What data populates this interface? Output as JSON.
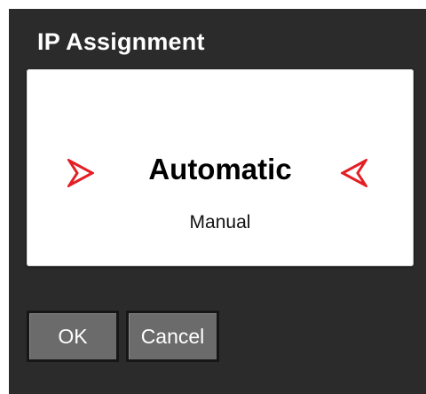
{
  "dialog": {
    "title": "IP Assignment",
    "options": [
      "Automatic",
      "Manual"
    ],
    "selected": "Automatic",
    "buttons": {
      "ok_label": "OK",
      "cancel_label": "Cancel"
    }
  },
  "colors": {
    "dialog_bg": "#2b2b2b",
    "picker_bg": "#ffffff",
    "arrow": "#e31e24",
    "button_bg": "#6b6b6b"
  },
  "icons": {
    "left": "chevron-right-icon",
    "right": "chevron-left-icon"
  }
}
